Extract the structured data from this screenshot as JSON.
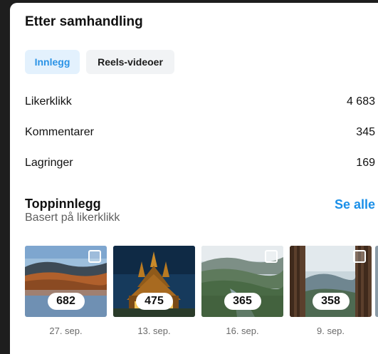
{
  "section": {
    "title": "Etter samhandling"
  },
  "tabs": [
    {
      "label": "Innlegg",
      "selected": true
    },
    {
      "label": "Reels-videoer",
      "selected": false
    }
  ],
  "metrics": [
    {
      "label": "Likerklikk",
      "value": "4 683"
    },
    {
      "label": "Kommentarer",
      "value": "345"
    },
    {
      "label": "Lagringer",
      "value": "169"
    }
  ],
  "top_posts": {
    "title": "Toppinnlegg",
    "subtitle": "Basert på likerklikk",
    "see_all": "Se alle",
    "posts": [
      {
        "count": "682",
        "date": "27. sep."
      },
      {
        "count": "475",
        "date": "13. sep."
      },
      {
        "count": "365",
        "date": "16. sep."
      },
      {
        "count": "358",
        "date": "9. sep."
      }
    ]
  },
  "colors": {
    "accent": "#1a8fe8",
    "tab_selected_bg": "#e3f1fd",
    "tab_bg": "#f1f3f5"
  }
}
